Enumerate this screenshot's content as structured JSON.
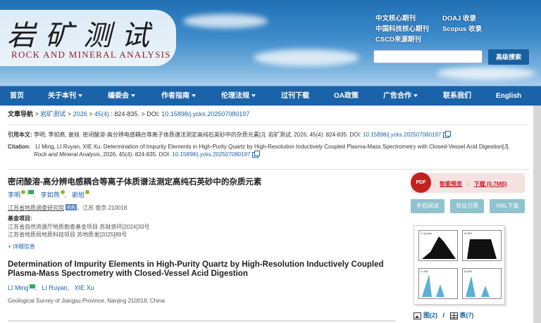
{
  "header": {
    "logo_cn": "岩矿测试",
    "logo_en": "ROCK AND MINERAL ANALYSIS",
    "index_links": [
      "中文核心期刊",
      "DOAJ 收录",
      "中国科技核心期刊",
      "Scopus 收录",
      "CSCD来源期刊"
    ],
    "search_placeholder": "",
    "advanced_search": "高级搜索"
  },
  "nav": {
    "items": [
      {
        "label": "首页",
        "dropdown": false
      },
      {
        "label": "关于本刊",
        "dropdown": true
      },
      {
        "label": "编委会",
        "dropdown": true
      },
      {
        "label": "作者指南",
        "dropdown": true
      },
      {
        "label": "伦理法规",
        "dropdown": true
      },
      {
        "label": "过刊下载",
        "dropdown": false
      },
      {
        "label": "OA政策",
        "dropdown": false
      },
      {
        "label": "广告合作",
        "dropdown": true
      },
      {
        "label": "联系我们",
        "dropdown": false
      },
      {
        "label": "English",
        "dropdown": false
      }
    ]
  },
  "breadcrumb": {
    "label": "文章导航",
    "journal": "岩矿测试",
    "year": "2026",
    "issue": "45(4)",
    "pages": ": 824-835.",
    "doi_label": "> DOI:",
    "doi": "10.15898/j.ycks.202507080197"
  },
  "citation": {
    "cn_label": "引用本文:",
    "cn_text": "李明, 李如燕, 谢旭. 密闭酸溶-高分辨电感耦合等离子体质谱法测定高纯石英砂中的杂质元素[J]. 岩矿测试, 2026, 45(4): 824-835. DOI:",
    "cn_doi": "10.15898/j.ycks.202507080197",
    "en_label": "Citation:",
    "en_text_1": "LI Ming, LI Ruyan, XIE Xu. Determination of Impurity Elements in High-Purity Quartz by High-Resolution Inductively Coupled Plasma-Mass Spectrometry with Closed-Vessel Acid Digestion[J].",
    "en_journal": "Rock and Mineral Analysis",
    "en_text_2": ", 2026, 45(4): 824-835. DOI:",
    "en_doi": "10.15898/j.ycks.202507080197"
  },
  "article": {
    "title_cn": "密闭酸溶-高分辨电感耦合等离子体质谱法测定高纯石英砂中的杂质元素",
    "authors_cn": [
      "李明",
      "李如燕",
      "谢旭"
    ],
    "affiliation_cn": "江苏省地质调查研究院",
    "affiliation_tag": "机构",
    "affiliation_loc": "，江苏 南京 210018",
    "fund_label": "基金项目:",
    "fund_1": "江苏省自然资源厅地质勘查基金项目 苏财资环[2024]33号",
    "fund_2": "江苏省地质局地质科技项目 苏地质发[2025]89号",
    "more_info": "+ 详细信息",
    "title_en": "Determination of Impurity Elements in High-Purity Quartz by High-Resolution Inductively Coupled Plasma-Mass Spectrometry with Closed-Vessel Acid Digestion",
    "authors_en": [
      "LI Ming",
      "LI Ruyan",
      "XIE Xu"
    ],
    "affiliation_en": "Geological Survey of Jiangsu Province, Nanjing 210018, China"
  },
  "sidebar": {
    "pdf_icon": "PDF",
    "preview": "智能预览",
    "download": "下载 (0.7MB)",
    "btn_read": "手机阅读",
    "btn_export": "导出引用",
    "btn_xml": "XML下载",
    "figures": "图(2)",
    "tables": "表(7)",
    "mini_labels": [
      "Li Quartz",
      "Al SM",
      "Li SM",
      "Al SM"
    ]
  },
  "colors": {
    "nav": "#1b63a8",
    "link": "#1b63a8",
    "accent": "#c51f1f",
    "button": "#8fc3ce"
  }
}
